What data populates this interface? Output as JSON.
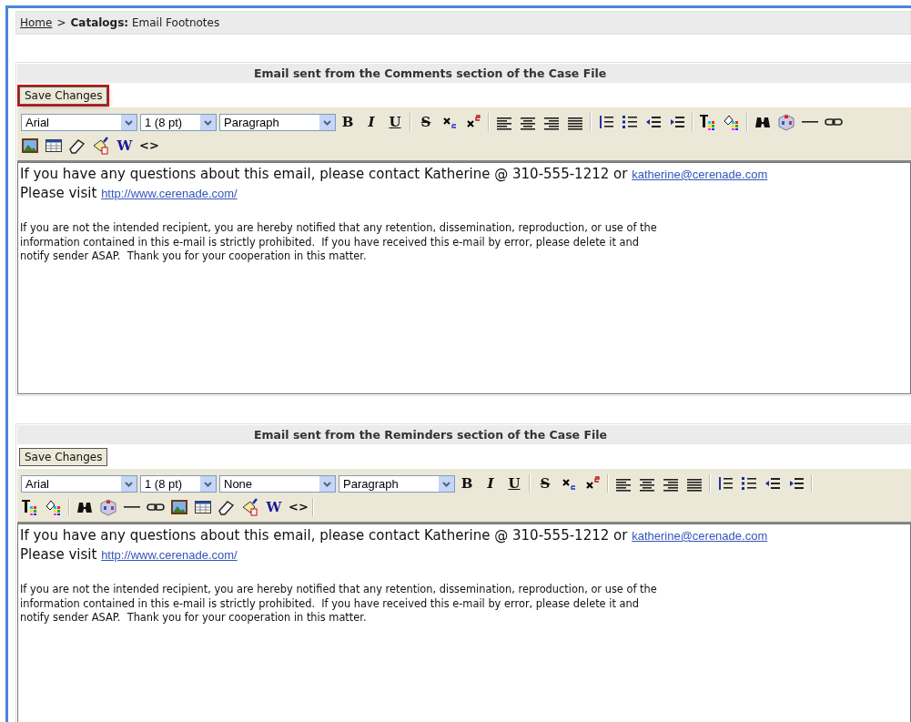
{
  "breadcrumb": {
    "home": "Home",
    "separator": ">",
    "current": "Catalogs:",
    "current_rest": "Email Footnotes"
  },
  "sections": [
    {
      "title": "Email sent from the Comments section of the Case File",
      "save_button": {
        "label": "Save Changes",
        "highlighted": true
      },
      "toolbar_rows": [
        [
          {
            "kind": "select",
            "value": "Arial"
          },
          {
            "kind": "select",
            "value": "1 (8 pt)"
          },
          {
            "kind": "select",
            "value": "Paragraph"
          },
          {
            "kind": "bold",
            "label": "B"
          },
          {
            "kind": "italic",
            "label": "I"
          },
          {
            "kind": "underline",
            "label": "U"
          },
          {
            "kind": "separator"
          },
          {
            "kind": "strike",
            "label": "S"
          },
          {
            "kind": "subscript"
          },
          {
            "kind": "superscript"
          },
          {
            "kind": "separator"
          },
          {
            "kind": "alignleft"
          },
          {
            "kind": "aligncenter"
          },
          {
            "kind": "alignright"
          },
          {
            "kind": "justify"
          },
          {
            "kind": "separator"
          },
          {
            "kind": "orderedlist"
          },
          {
            "kind": "bulletlist"
          },
          {
            "kind": "outdent"
          },
          {
            "kind": "indent"
          },
          {
            "kind": "separator"
          },
          {
            "kind": "textcolor"
          },
          {
            "kind": "fillcolor"
          },
          {
            "kind": "separator"
          },
          {
            "kind": "find"
          },
          {
            "kind": "cube"
          },
          {
            "kind": "rule"
          },
          {
            "kind": "link"
          }
        ],
        [
          {
            "kind": "image"
          },
          {
            "kind": "table"
          },
          {
            "kind": "eraser"
          },
          {
            "kind": "clean"
          },
          {
            "kind": "word",
            "label": "W"
          },
          {
            "kind": "code",
            "label": "<>"
          }
        ]
      ],
      "content": {
        "contact": "If you have any questions about this email, please contact Katherine @ 310-555-1212 or ",
        "email": "katherine@cerenade.com",
        "visit": "Please visit ",
        "url": "http://www.cerenade.com/",
        "disclaimer": [
          "If you are not the intended recipient, you are hereby notified that any retention, dissemination, reproduction, or use of the",
          "information contained in this e-mail is strictly prohibited.  If you have received this e-mail by error, please delete it and",
          "notify sender ASAP.  Thank you for your cooperation in this matter."
        ]
      }
    },
    {
      "title": "Email sent from the Reminders section of the Case File",
      "save_button": {
        "label": "Save Changes",
        "highlighted": false
      },
      "toolbar_rows": [
        [
          {
            "kind": "select",
            "value": "Arial"
          },
          {
            "kind": "select",
            "value": "1 (8 pt)"
          },
          {
            "kind": "select",
            "value": "None"
          },
          {
            "kind": "select",
            "value": "Paragraph"
          },
          {
            "kind": "bold",
            "label": "B"
          },
          {
            "kind": "italic",
            "label": "I"
          },
          {
            "kind": "underline",
            "label": "U"
          },
          {
            "kind": "separator"
          },
          {
            "kind": "strike",
            "label": "S"
          },
          {
            "kind": "subscript"
          },
          {
            "kind": "superscript"
          },
          {
            "kind": "separator"
          },
          {
            "kind": "alignleft"
          },
          {
            "kind": "aligncenter"
          },
          {
            "kind": "alignright"
          },
          {
            "kind": "justify"
          },
          {
            "kind": "separator"
          },
          {
            "kind": "orderedlist"
          },
          {
            "kind": "bulletlist"
          },
          {
            "kind": "outdent"
          },
          {
            "kind": "indent"
          },
          {
            "kind": "separator"
          }
        ],
        [
          {
            "kind": "textcolor"
          },
          {
            "kind": "fillcolor"
          },
          {
            "kind": "separator"
          },
          {
            "kind": "find"
          },
          {
            "kind": "cube"
          },
          {
            "kind": "rule"
          },
          {
            "kind": "link"
          },
          {
            "kind": "image"
          },
          {
            "kind": "table"
          },
          {
            "kind": "eraser"
          },
          {
            "kind": "clean"
          },
          {
            "kind": "word",
            "label": "W"
          },
          {
            "kind": "code",
            "label": "<>"
          },
          {
            "kind": "separator"
          }
        ]
      ],
      "content": {
        "contact": "If you have any questions about this email, please contact Katherine @ 310-555-1212 or ",
        "email": "katherine@cerenade.com",
        "visit": "Please visit ",
        "url": "http://www.cerenade.com/",
        "disclaimer": [
          "If you are not the intended recipient, you are hereby notified that any retention, dissemination, reproduction, or use of the",
          "information contained in this e-mail is strictly prohibited.  If you have received this e-mail by error, please delete it and",
          "notify sender ASAP.  Thank you for your cooperation in this matter."
        ]
      }
    }
  ]
}
